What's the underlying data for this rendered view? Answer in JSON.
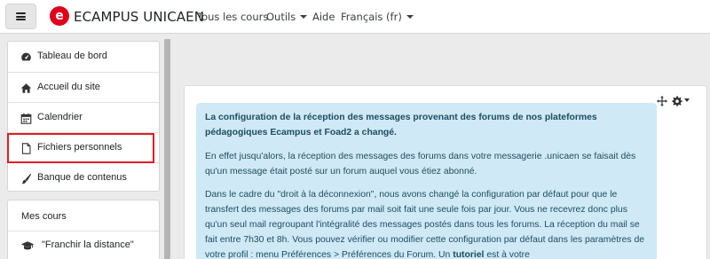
{
  "navbar": {
    "brand": "ECAMPUS UNICAEN",
    "logo_letter": "e",
    "links": [
      {
        "label": "Tous les cours"
      },
      {
        "label": "Outils"
      },
      {
        "label": "Aide"
      },
      {
        "label": "Français (fr)"
      }
    ]
  },
  "sidebar": {
    "items": [
      {
        "label": "Tableau de bord",
        "icon": "dashboard-icon"
      },
      {
        "label": "Accueil du site",
        "icon": "home-icon"
      },
      {
        "label": "Calendrier",
        "icon": "calendar-icon"
      },
      {
        "label": "Fichiers personnels",
        "icon": "file-icon"
      },
      {
        "label": "Banque de contenus",
        "icon": "brush-icon"
      }
    ],
    "section_title": "Mes cours",
    "courses": [
      {
        "label": "\"Franchir la distance\"",
        "icon": "graduation-cap-icon"
      }
    ]
  },
  "content": {
    "heading": "La configuration de la réception des messages provenant des forums de nos plateformes pédagogiques Ecampus et Foad2 a changé.",
    "para1": "En effet jusqu'alors, la réception des messages des forums dans votre messagerie .unicaen se faisait dès qu'un message était posté sur un forum auquel vous étiez abonné.",
    "para2_start": "Dans le cadre du \"droit à la déconnexion\", nous avons changé la configuration par défaut pour que le transfert des messages des forums par mail soit fait une seule fois par jour. Vous ne recevrez donc plus qu'un seul mail regroupant l'intégralité des messages postés dans tous les forums. La réception du mail se fait entre 7h30 et 8h. Vous pouvez vérifier ou modifier cette configuration par défaut dans les paramètres de votre profil : menu Préférences > Préférences du Forum. Un ",
    "para2_bold": "tutoriel",
    "para2_end": " est à votre"
  },
  "colors": {
    "accent": "#e2001a",
    "info_bg": "#cfe9f6",
    "info_text": "#1e4d60",
    "highlight": "#e31b23"
  }
}
